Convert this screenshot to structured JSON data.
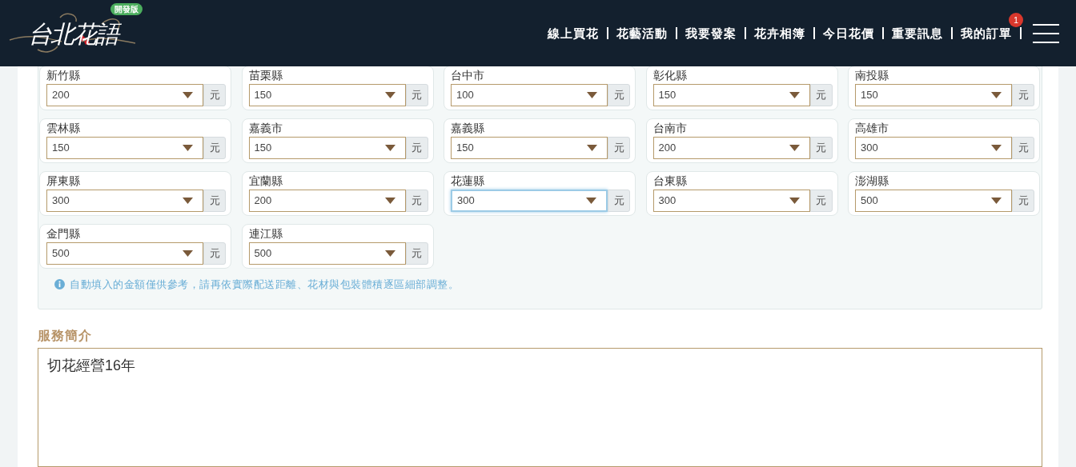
{
  "header": {
    "logo": "台北花語",
    "badge": "開發版",
    "nav": [
      {
        "label": "線上買花"
      },
      {
        "label": "花藝活動"
      },
      {
        "label": "我要發案"
      },
      {
        "label": "花卉相簿"
      },
      {
        "label": "今日花價"
      },
      {
        "label": "重要訊息"
      },
      {
        "label": "我的訂單",
        "count": "1"
      }
    ]
  },
  "shipping_fees": [
    {
      "region": "新竹縣",
      "value": "200",
      "unit": "元",
      "focused": false
    },
    {
      "region": "苗栗縣",
      "value": "150",
      "unit": "元",
      "focused": false
    },
    {
      "region": "台中市",
      "value": "100",
      "unit": "元",
      "focused": false
    },
    {
      "region": "彰化縣",
      "value": "150",
      "unit": "元",
      "focused": false
    },
    {
      "region": "南投縣",
      "value": "150",
      "unit": "元",
      "focused": false
    },
    {
      "region": "雲林縣",
      "value": "150",
      "unit": "元",
      "focused": false
    },
    {
      "region": "嘉義市",
      "value": "150",
      "unit": "元",
      "focused": false
    },
    {
      "region": "嘉義縣",
      "value": "150",
      "unit": "元",
      "focused": false
    },
    {
      "region": "台南市",
      "value": "200",
      "unit": "元",
      "focused": false
    },
    {
      "region": "高雄市",
      "value": "300",
      "unit": "元",
      "focused": false
    },
    {
      "region": "屏東縣",
      "value": "300",
      "unit": "元",
      "focused": false
    },
    {
      "region": "宜蘭縣",
      "value": "200",
      "unit": "元",
      "focused": false
    },
    {
      "region": "花蓮縣",
      "value": "300",
      "unit": "元",
      "focused": true
    },
    {
      "region": "台東縣",
      "value": "300",
      "unit": "元",
      "focused": false
    },
    {
      "region": "澎湖縣",
      "value": "500",
      "unit": "元",
      "focused": false
    },
    {
      "region": "金門縣",
      "value": "500",
      "unit": "元",
      "focused": false
    },
    {
      "region": "連江縣",
      "value": "500",
      "unit": "元",
      "focused": false
    }
  ],
  "note": "自動填入的金額僅供參考，請再依實際配送距離、花材與包裝體積逐區細部調整。",
  "service_intro": {
    "label": "服務簡介",
    "value": "切花經營16年"
  }
}
